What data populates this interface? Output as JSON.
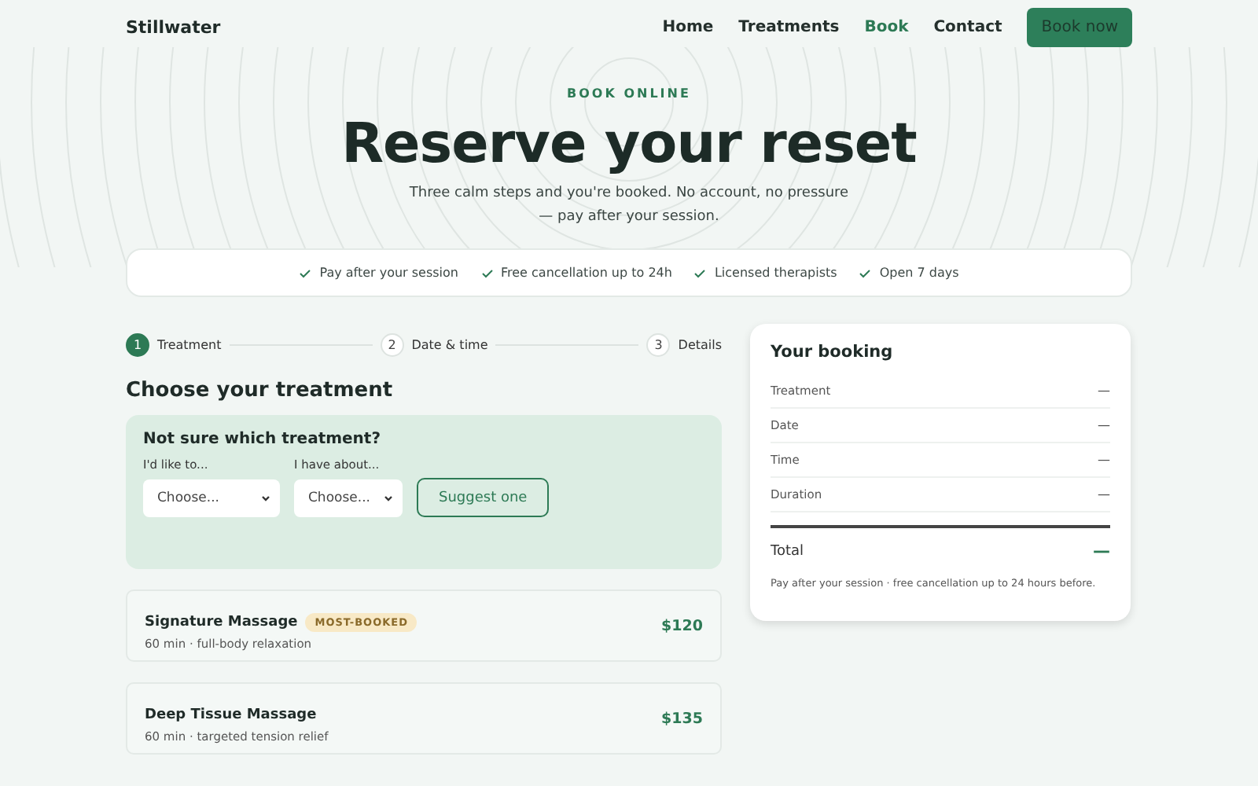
{
  "brand": "Stillwater",
  "nav": [
    {
      "label": "Home",
      "selected": false
    },
    {
      "label": "Treatments",
      "selected": false
    },
    {
      "label": "Book",
      "selected": true
    },
    {
      "label": "Contact",
      "selected": false
    }
  ],
  "nav_button": "Book now",
  "hero": {
    "eyebrow": "BOOK ONLINE",
    "title": "Reserve your reset",
    "subtitle": "Three calm steps and you're booked. No account, no pressure — pay after your session."
  },
  "trust": [
    "Pay after your session",
    "Free cancellation up to 24h",
    "Licensed therapists",
    "Open 7 days"
  ],
  "steps": [
    {
      "number": "1",
      "label": "Treatment",
      "selected": true
    },
    {
      "number": "2",
      "label": "Date & time",
      "selected": false
    },
    {
      "number": "3",
      "label": "Details",
      "selected": false
    }
  ],
  "section_title": "Choose your treatment",
  "helper": {
    "title": "Not sure which treatment?",
    "fields": [
      {
        "label": "I'd like to...",
        "value": "Choose..."
      },
      {
        "label": "I have about...",
        "value": "Choose..."
      }
    ],
    "button": "Suggest one"
  },
  "treatments": [
    {
      "name": "Signature Massage",
      "badge": "MOST-BOOKED",
      "detail": "60 min · full-body relaxation",
      "price": "$120"
    },
    {
      "name": "Deep Tissue Massage",
      "detail": "60 min · targeted tension relief",
      "price": "$135"
    }
  ],
  "summary": {
    "title": "Your booking",
    "rows": [
      {
        "label": "Treatment",
        "value": "—"
      },
      {
        "label": "Date",
        "value": "—"
      },
      {
        "label": "Time",
        "value": "—"
      },
      {
        "label": "Duration",
        "value": "—"
      }
    ],
    "total_label": "Total",
    "total_value": "—",
    "note": "Pay after your session · free cancellation up to 24 hours before."
  }
}
